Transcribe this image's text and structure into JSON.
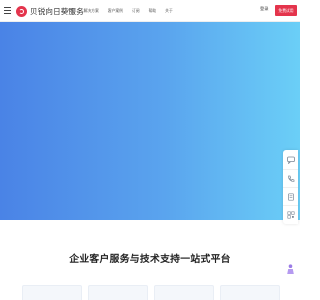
{
  "header": {
    "logo_text": "贝锐向日葵服务",
    "nav": [
      {
        "label": "产品"
      },
      {
        "label": "解决方案"
      },
      {
        "label": "客户案例"
      },
      {
        "label": "订阅"
      },
      {
        "label": "帮助"
      },
      {
        "label": "关于"
      }
    ],
    "login_label": "登录",
    "cta_label": "免费试用"
  },
  "hero": {
    "gradient_from": "#4a83e6",
    "gradient_to": "#6bcff7"
  },
  "side_toolbar": {
    "items": [
      {
        "icon": "chat-icon"
      },
      {
        "icon": "phone-icon"
      },
      {
        "icon": "document-icon"
      },
      {
        "icon": "qr-code-icon"
      }
    ],
    "back_to_top_icon": "person-up-icon"
  },
  "main": {
    "section_title": "企业客户服务与技术支持一站式平台",
    "cards_count": 4
  },
  "colors": {
    "brand": "#e4344c",
    "text_primary": "#222222"
  }
}
